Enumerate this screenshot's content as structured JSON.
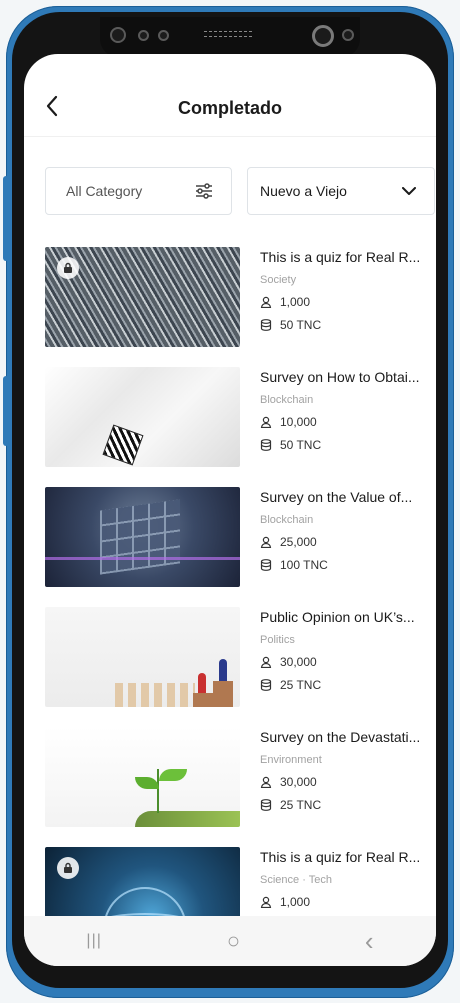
{
  "header": {
    "title": "Completado",
    "back_icon": "chevron-left-icon"
  },
  "filters": {
    "category_label": "All Category",
    "category_icon": "sliders-icon",
    "sort_label": "Nuevo a Viejo",
    "sort_icon": "chevron-down-icon"
  },
  "items": [
    {
      "title": "This is a quiz for Real R...",
      "category": "Society",
      "participants": "1,000",
      "reward": "50 TNC",
      "locked": true
    },
    {
      "title": "Survey on How to Obtai...",
      "category": "Blockchain",
      "participants": "10,000",
      "reward": "50 TNC",
      "locked": false
    },
    {
      "title": "Survey on the Value of...",
      "category": "Blockchain",
      "participants": "25,000",
      "reward": "100 TNC",
      "locked": false
    },
    {
      "title": "Public Opinion on UK’s...",
      "category": "Politics",
      "participants": "30,000",
      "reward": "25 TNC",
      "locked": false
    },
    {
      "title": "Survey on the Devastati...",
      "category": "Environment",
      "participants": "30,000",
      "reward": "25 TNC",
      "locked": false
    },
    {
      "title": "This is a quiz for Real R...",
      "category": "Science · Tech",
      "participants": "1,000",
      "reward": "",
      "locked": true
    }
  ],
  "navbar": {
    "recent_symbol": "|||",
    "home_symbol": "○",
    "back_symbol": "‹"
  },
  "colors": {
    "phone_frame": "#2f7ab8",
    "screen_bg": "#ffffff",
    "text_primary": "#1b1b1b",
    "text_muted": "#a2a2a2"
  }
}
